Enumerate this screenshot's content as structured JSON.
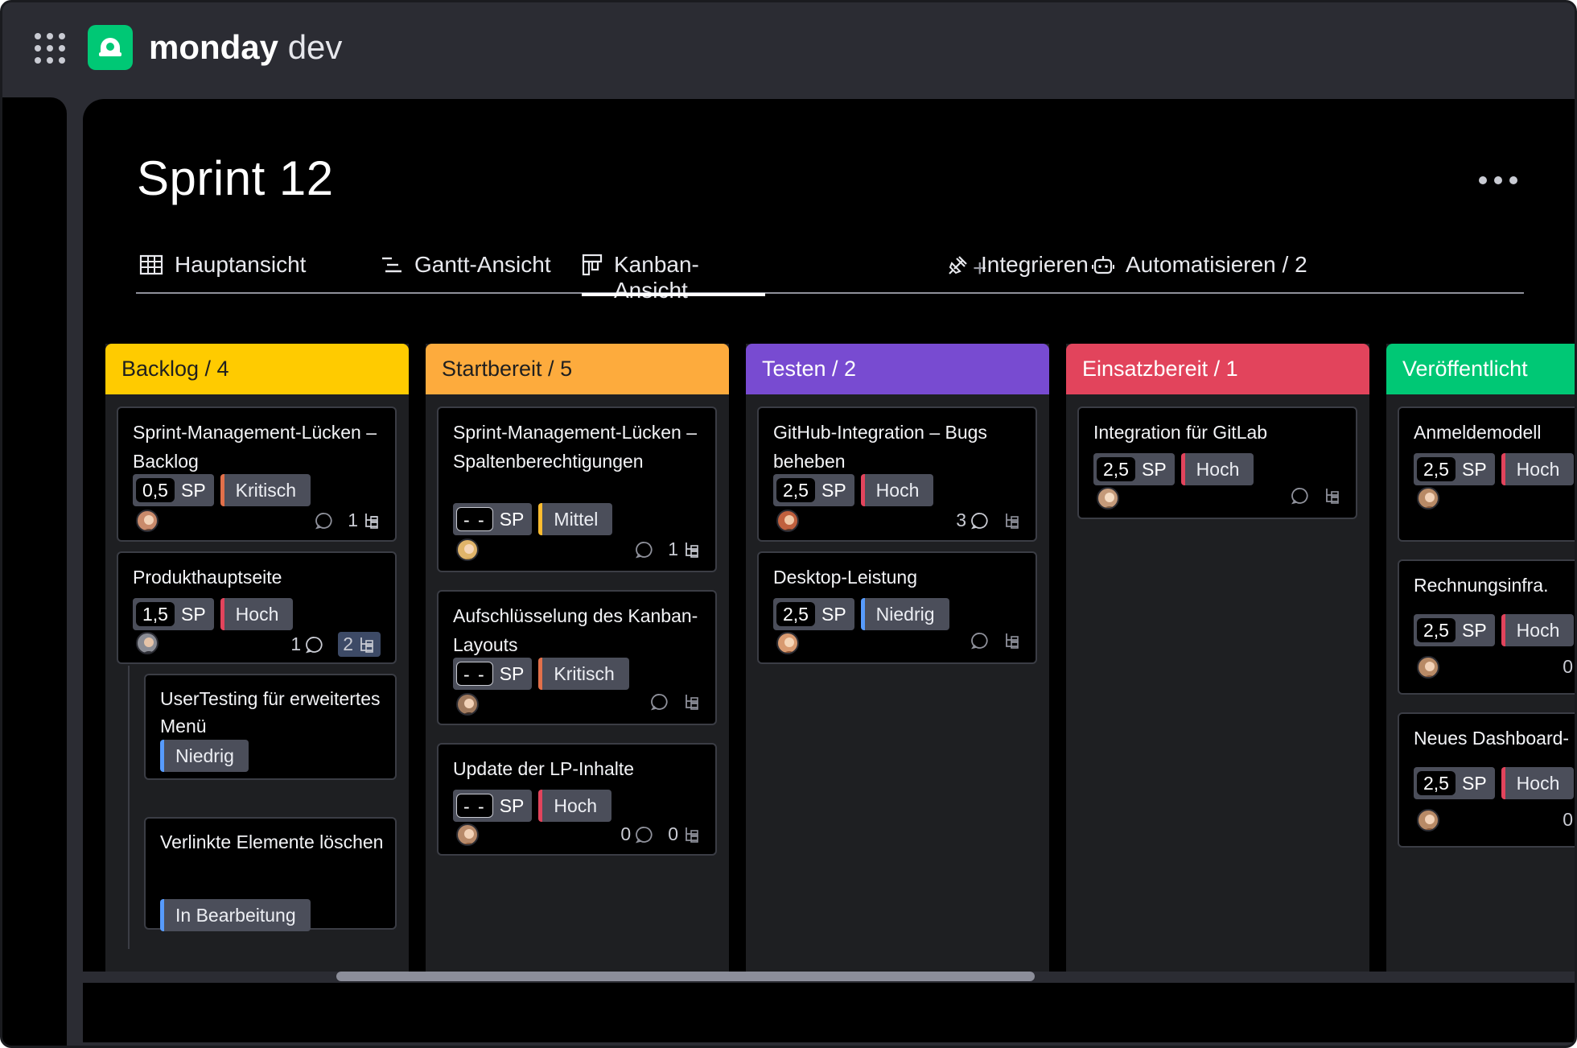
{
  "app": {
    "brand_bold": "monday",
    "brand_light": "dev"
  },
  "page": {
    "title": "Sprint 12"
  },
  "tabs": [
    {
      "label": "Hauptansicht",
      "icon": "table-icon"
    },
    {
      "label": "Gantt-Ansicht",
      "icon": "gantt-icon"
    },
    {
      "label": "Kanban-Ansicht",
      "icon": "kanban-icon",
      "active": true
    }
  ],
  "tab_add": "+",
  "actions": {
    "integrate": "Integrieren",
    "automate": "Automatisieren / 2"
  },
  "colors": {
    "backlog": "#ffcb00",
    "startbereit": "#fdab3d",
    "testen": "#784bd1",
    "einsatzbereit": "#e2445c",
    "veroeffentlicht": "#00c875"
  },
  "columns": [
    {
      "title": "Backlog / 4",
      "cards": [
        {
          "title": "Sprint-Management-Lücken – Backlog",
          "sp": "0,5",
          "sp_unit": "SP",
          "priority": "Kritisch",
          "subitems": "1"
        },
        {
          "title": "Produkthauptseite",
          "sp": "1,5",
          "sp_unit": "SP",
          "priority": "Hoch",
          "comments": "1",
          "subitems": "2"
        },
        {
          "title": "UserTesting für erweitertes Menü",
          "priority": "Niedrig"
        },
        {
          "title": "Verlinkte Elemente löschen",
          "priority": "In Bearbeitung"
        }
      ]
    },
    {
      "title": "Startbereit / 5",
      "cards": [
        {
          "title": "Sprint-Management-Lücken – Spaltenberechtigungen",
          "sp": "- -",
          "sp_unit": "SP",
          "priority": "Mittel",
          "subitems": "1"
        },
        {
          "title": "Aufschlüsselung des Kanban-Layouts",
          "sp": "- -",
          "sp_unit": "SP",
          "priority": "Kritisch"
        },
        {
          "title": "Update der LP-Inhalte",
          "sp": "- -",
          "sp_unit": "SP",
          "priority": "Hoch",
          "comments": "0",
          "subitems": "0"
        }
      ]
    },
    {
      "title": "Testen / 2",
      "cards": [
        {
          "title": "GitHub-Integration – Bugs beheben",
          "sp": "2,5",
          "sp_unit": "SP",
          "priority": "Hoch",
          "comments": "3"
        },
        {
          "title": "Desktop-Leistung",
          "sp": "2,5",
          "sp_unit": "SP",
          "priority": "Niedrig"
        }
      ]
    },
    {
      "title": "Einsatzbereit / 1",
      "cards": [
        {
          "title": "Integration für GitLab",
          "sp": "2,5",
          "sp_unit": "SP",
          "priority": "Hoch"
        }
      ]
    },
    {
      "title": "Veröffentlicht",
      "cards": [
        {
          "title": "Anmeldemodell",
          "sp": "2,5",
          "sp_unit": "SP",
          "priority": "Hoch"
        },
        {
          "title": "Rechnungsinfra.",
          "sp": "2,5",
          "sp_unit": "SP",
          "priority": "Hoch",
          "comments": "0"
        },
        {
          "title": "Neues Dashboard-",
          "sp": "2,5",
          "sp_unit": "SP",
          "priority": "Hoch",
          "comments": "0"
        }
      ]
    }
  ]
}
